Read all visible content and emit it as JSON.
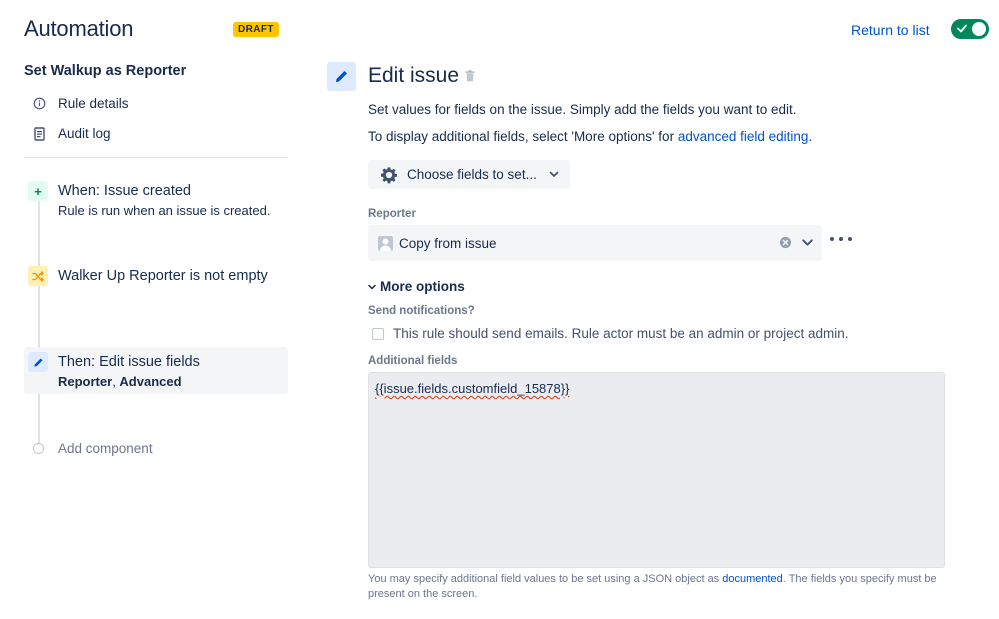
{
  "header": {
    "app_title": "Automation",
    "draft_badge": "DRAFT",
    "return_link": "Return to list",
    "enabled": true,
    "toggle_color": "#00875a"
  },
  "sidebar": {
    "rule_name": "Set Walkup as Reporter",
    "links": [
      {
        "label": "Rule details",
        "icon": "info-icon"
      },
      {
        "label": "Audit log",
        "icon": "document-icon"
      }
    ],
    "steps": [
      {
        "title": "When: Issue created",
        "sub": "Rule is run when an issue is created.",
        "icon": "plus-icon",
        "badge_color": "#e3fcef",
        "icon_color": "#00875a"
      },
      {
        "title": "Walker Up Reporter is not empty",
        "icon": "shuffle-icon",
        "badge_color": "#fff0b3",
        "icon_color": "#ff8b00"
      },
      {
        "title": "Then: Edit issue fields",
        "sub_part1": "Reporter",
        "sub_sep": ", ",
        "sub_part2": "Advanced",
        "icon": "pencil-icon",
        "badge_color": "#deebff",
        "icon_color": "#0052cc",
        "selected": true
      }
    ],
    "add_component": "Add component"
  },
  "main": {
    "title": "Edit issue",
    "desc1": "Set values for fields on the issue. Simply add the fields you want to edit.",
    "desc2_prefix": "To display additional fields, select 'More options' for ",
    "desc2_link": "advanced field editing",
    "desc2_suffix": ".",
    "choose_fields": "Choose fields to set...",
    "reporter_label": "Reporter",
    "reporter_value": "Copy from issue",
    "more_options": "More options",
    "send_notifications_label": "Send notifications?",
    "send_notifications_text": "This rule should send emails. Rule actor must be an admin or project admin.",
    "send_notifications_checked": false,
    "additional_fields_label": "Additional fields",
    "additional_fields_value": "{{issue.fields.customfield_15878}}",
    "help_prefix": "You may specify additional field values to be set using a JSON object as ",
    "help_link": "documented",
    "help_suffix": ". The fields you specify must be present on the screen."
  }
}
